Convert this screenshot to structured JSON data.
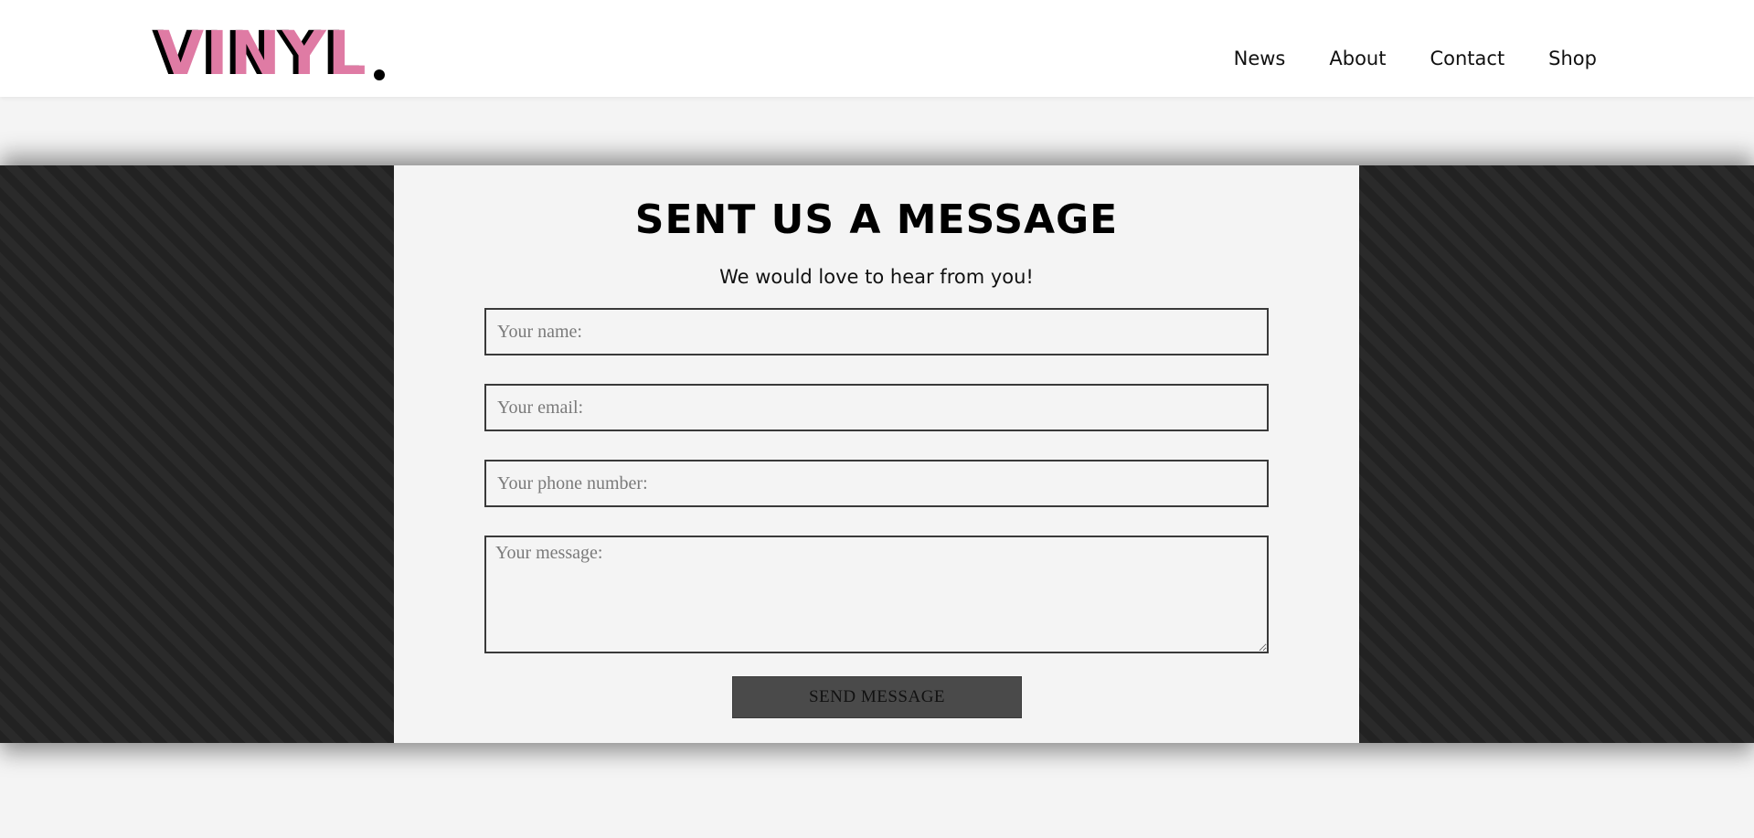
{
  "header": {
    "logo_text": "VINYL",
    "nav": [
      {
        "label": "News"
      },
      {
        "label": "About"
      },
      {
        "label": "Contact"
      },
      {
        "label": "Shop"
      }
    ]
  },
  "contact_form": {
    "title": "SENT US A MESSAGE",
    "subtitle": "We would love to hear from you!",
    "fields": {
      "name_placeholder": "Your name:",
      "email_placeholder": "Your email:",
      "phone_placeholder": "Your phone number:",
      "message_placeholder": "Your message:"
    },
    "submit_label": "SEND MESSAGE"
  },
  "colors": {
    "brand_pink": "#df7ba4",
    "band_dark": "#222222",
    "panel_bg": "#f4f4f4",
    "button_bg": "#4a4a4a"
  }
}
